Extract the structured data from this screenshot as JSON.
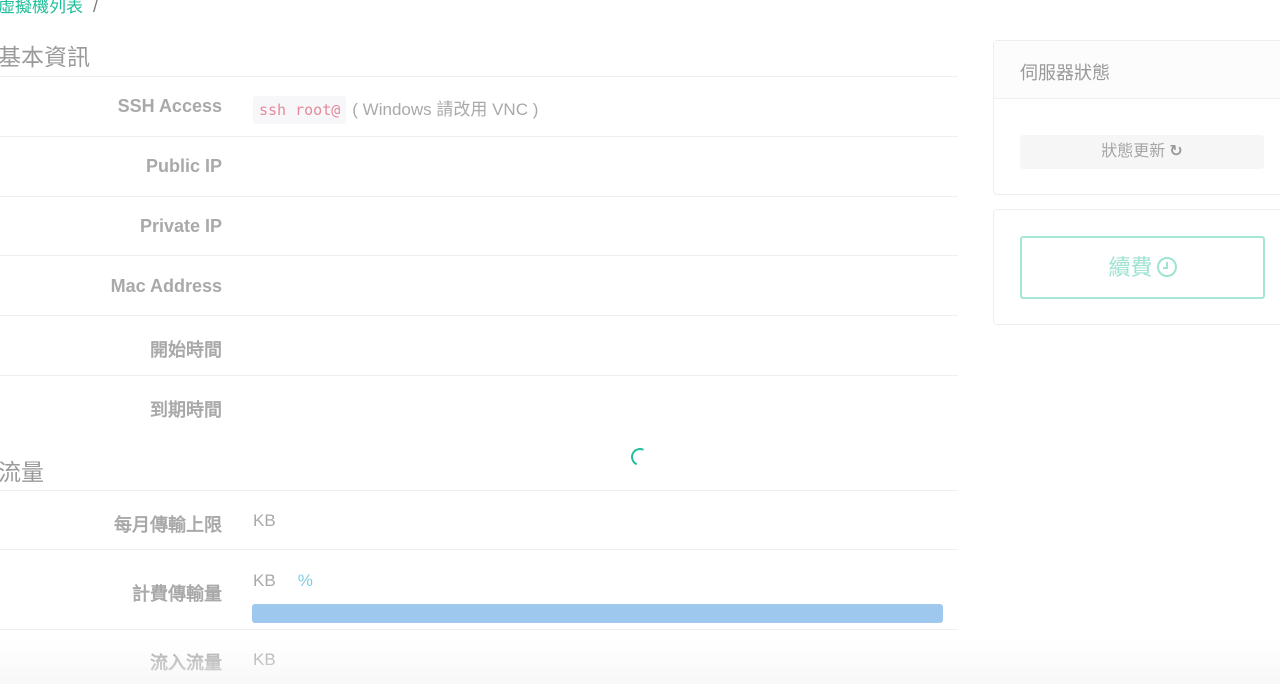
{
  "breadcrumb": {
    "link": "虛擬機列表",
    "separator": "/"
  },
  "basic_info": {
    "title": "基本資訊",
    "ssh": {
      "label": "SSH Access",
      "code": "ssh root@",
      "note": "( Windows 請改用 VNC )"
    },
    "public_ip": {
      "label": "Public IP",
      "value": ""
    },
    "private_ip": {
      "label": "Private IP",
      "value": ""
    },
    "mac_address": {
      "label": "Mac Address",
      "value": ""
    },
    "start_time": {
      "label": "開始時間",
      "value": ""
    },
    "expire_time": {
      "label": "到期時間",
      "value": ""
    }
  },
  "traffic": {
    "title": "流量",
    "monthly_limit": {
      "label": "每月傳輸上限",
      "unit": "KB"
    },
    "billed": {
      "label": "計費傳輸量",
      "unit": "KB",
      "percent_sign": "%",
      "progress": 1.0
    },
    "inbound": {
      "label": "流入流量",
      "unit": "KB"
    }
  },
  "server_status": {
    "title": "伺服器狀態",
    "refresh_label": "狀態更新",
    "refresh_icon": "refresh-icon"
  },
  "renew": {
    "label": "續費",
    "icon": "clock-icon"
  },
  "colors": {
    "accent": "#1fbf9a",
    "progress": "#9ec8ee",
    "renew_border": "#a5e6d6"
  }
}
